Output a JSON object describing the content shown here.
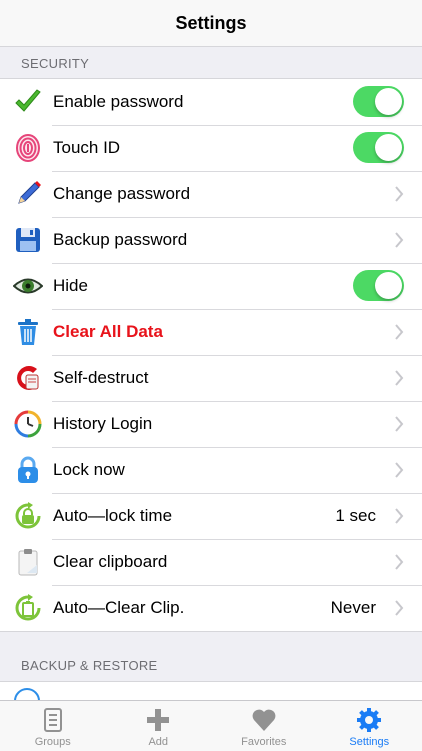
{
  "navbar": {
    "title": "Settings"
  },
  "sections": [
    {
      "header": "SECURITY"
    },
    {
      "header": "BACKUP & RESTORE"
    }
  ],
  "security": {
    "items": [
      {
        "label": "Enable password",
        "icon": "checkmark-icon",
        "control": "toggle",
        "on": true
      },
      {
        "label": "Touch ID",
        "icon": "fingerprint-icon",
        "control": "toggle",
        "on": true
      },
      {
        "label": "Change password",
        "icon": "pencil-icon",
        "control": "chevron"
      },
      {
        "label": "Backup password",
        "icon": "floppy-disk-icon",
        "control": "chevron"
      },
      {
        "label": "Hide",
        "icon": "eye-icon",
        "control": "toggle",
        "on": true
      },
      {
        "label": "Clear All Data",
        "icon": "trash-icon",
        "control": "chevron",
        "color": "#e8131b"
      },
      {
        "label": "Self-destruct",
        "icon": "self-destruct-icon",
        "control": "chevron"
      },
      {
        "label": "History Login",
        "icon": "history-clock-icon",
        "control": "chevron"
      },
      {
        "label": "Lock now",
        "icon": "padlock-icon",
        "control": "chevron"
      },
      {
        "label": "Auto—lock time",
        "icon": "auto-lock-icon",
        "control": "chevron",
        "value": "1 sec"
      },
      {
        "label": "Clear clipboard",
        "icon": "clipboard-icon",
        "control": "chevron"
      },
      {
        "label": "Auto—Clear Clip.",
        "icon": "auto-clear-clipboard-icon",
        "control": "chevron",
        "value": "Never"
      }
    ]
  },
  "tabbar": {
    "tabs": [
      {
        "label": "Groups",
        "icon": "list-icon",
        "active": false
      },
      {
        "label": "Add",
        "icon": "plus-icon",
        "active": false
      },
      {
        "label": "Favorites",
        "icon": "heart-icon",
        "active": false
      },
      {
        "label": "Settings",
        "icon": "gear-icon",
        "active": true
      }
    ]
  },
  "colors": {
    "toggle_on": "#4cd964",
    "accent": "#1a7cf5",
    "danger": "#e8131b",
    "background": "#efeff4"
  }
}
